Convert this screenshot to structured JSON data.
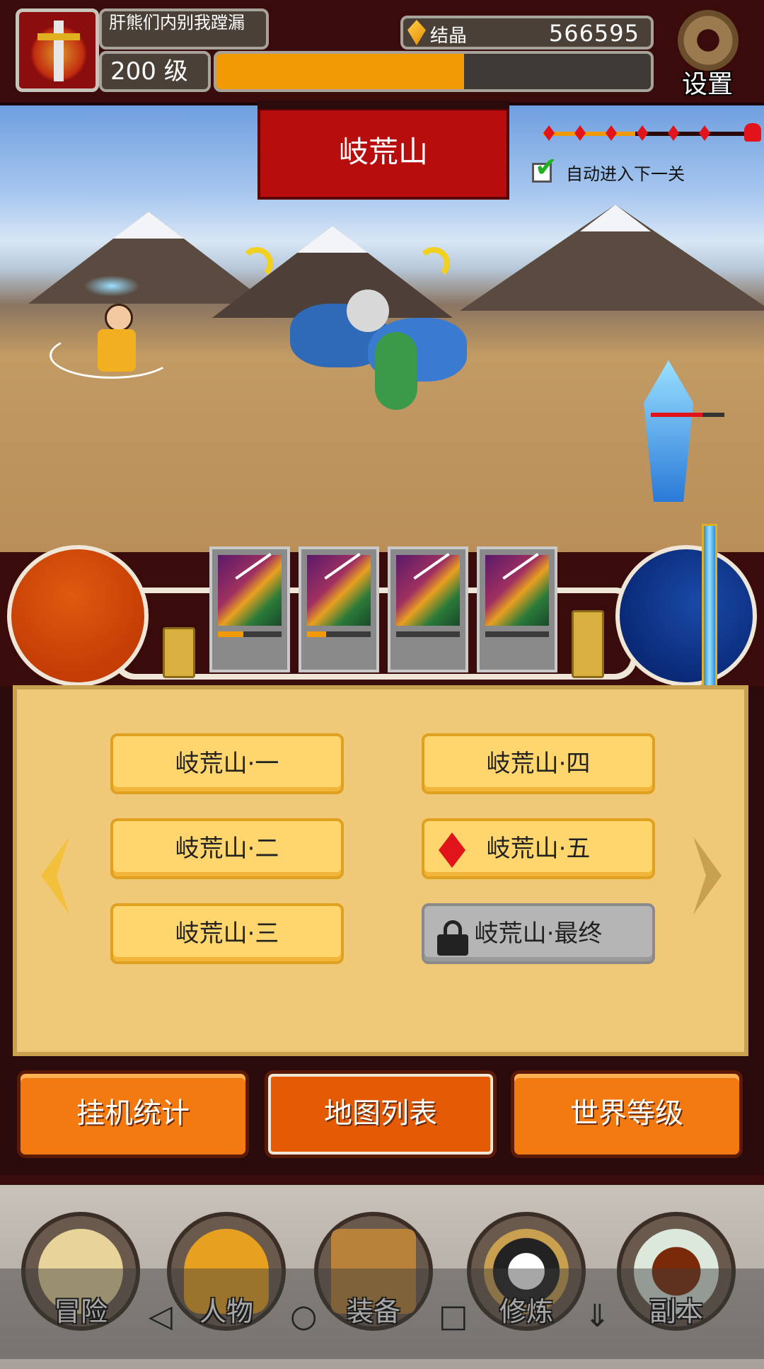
{
  "player": {
    "name": "肝熊们内别我蹚漏",
    "level": "200 级",
    "xp_fraction": 0.57
  },
  "currency": {
    "label": "结晶",
    "value": "566595"
  },
  "settings": {
    "label": "设置"
  },
  "stage": {
    "title": "岐荒山",
    "auto_next_label": "自动进入下一关",
    "auto_next_checked": true,
    "progress_nodes": 7,
    "current_node": 3
  },
  "skills": {
    "cards": [
      {
        "cooldown": 0.4
      },
      {
        "cooldown": 0.3
      },
      {
        "cooldown": 0.0
      },
      {
        "cooldown": 0.0
      }
    ]
  },
  "map_list": {
    "levels": [
      {
        "label": "岐荒山·一",
        "state": "normal"
      },
      {
        "label": "岐荒山·二",
        "state": "normal"
      },
      {
        "label": "岐荒山·三",
        "state": "normal"
      },
      {
        "label": "岐荒山·四",
        "state": "normal"
      },
      {
        "label": "岐荒山·五",
        "state": "current"
      },
      {
        "label": "岐荒山·最终",
        "state": "locked"
      }
    ]
  },
  "tabs": [
    {
      "label": "挂机统计",
      "active": false
    },
    {
      "label": "地图列表",
      "active": true
    },
    {
      "label": "世界等级",
      "active": false
    }
  ],
  "bottom_nav": [
    {
      "label": "冒险",
      "icon": "treasure-map-icon"
    },
    {
      "label": "人物",
      "icon": "helmet-icon"
    },
    {
      "label": "装备",
      "icon": "treasure-chest-icon"
    },
    {
      "label": "修炼",
      "icon": "yin-yang-icon"
    },
    {
      "label": "副本",
      "icon": "dungeon-gate-icon"
    }
  ],
  "colors": {
    "accent_orange": "#f29a05",
    "stage_red": "#b80d0d",
    "panel_parchment": "#f0c978"
  }
}
